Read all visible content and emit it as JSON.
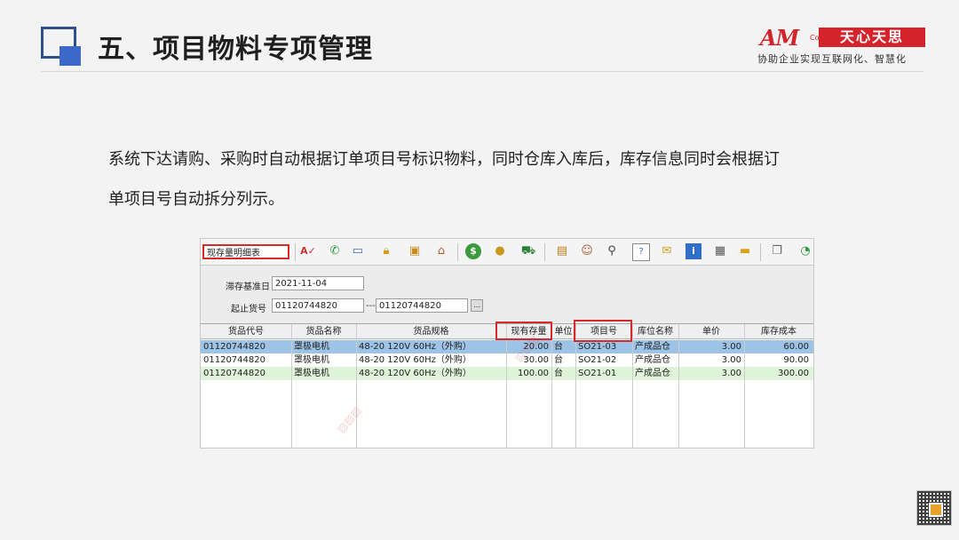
{
  "header": {
    "title": "五、项目物料专项管理",
    "logo_am": "AM",
    "logo_co": "Co.",
    "logo_cn": "天心天思",
    "tagline": "协助企业实现互联网化、智慧化"
  },
  "body": {
    "line1": "系统下达请购、采购时自动根据订单项目号标识物料，同时仓库入库后，库存信息同时会根据订",
    "line2": "单项目号自动拆分列示。"
  },
  "app": {
    "view_combo": "现存量明细表",
    "toolbar_icons": [
      "abc-check-icon",
      "phone-icon",
      "monitor-icon",
      "lock-icon",
      "briefcase-icon",
      "home-icon",
      "dollar-icon",
      "money-bag-icon",
      "cart-icon",
      "clipboard-icon",
      "users-icon",
      "link-icon",
      "help-doc-icon",
      "mail-icon",
      "info-icon",
      "calculator-icon",
      "folder-icon",
      "copy-icon"
    ],
    "form": {
      "date_label": "滞存基准日",
      "date_value": "2021-11-04",
      "range_label": "起止货号",
      "from_value": "01120744820",
      "range_sep": "---",
      "to_value": "01120744820",
      "browse_label": "..."
    },
    "table": {
      "columns": [
        "货品代号",
        "货品名称",
        "货品规格",
        "现有存量",
        "单位",
        "项目号",
        "库位名称",
        "单价",
        "库存成本"
      ],
      "rows": [
        [
          "01120744820",
          "罩极电机",
          "48-20 120V 60Hz（外购）",
          "20.00",
          "台",
          "SO21-03",
          "产成品仓",
          "3.00",
          "60.00"
        ],
        [
          "01120744820",
          "罩极电机",
          "48-20 120V 60Hz（外购）",
          "30.00",
          "台",
          "SO21-02",
          "产成品仓",
          "3.00",
          "90.00"
        ],
        [
          "01120744820",
          "罩极电机",
          "48-20 120V 60Hz（外购）",
          "100.00",
          "台",
          "SO21-01",
          "产成品仓",
          "3.00",
          "300.00"
        ]
      ]
    }
  },
  "colors": {
    "accent": "#3b68c9",
    "brand_red": "#d4232b",
    "highlight_row": "#9dc3e7",
    "green_row": "#dff3d8"
  }
}
